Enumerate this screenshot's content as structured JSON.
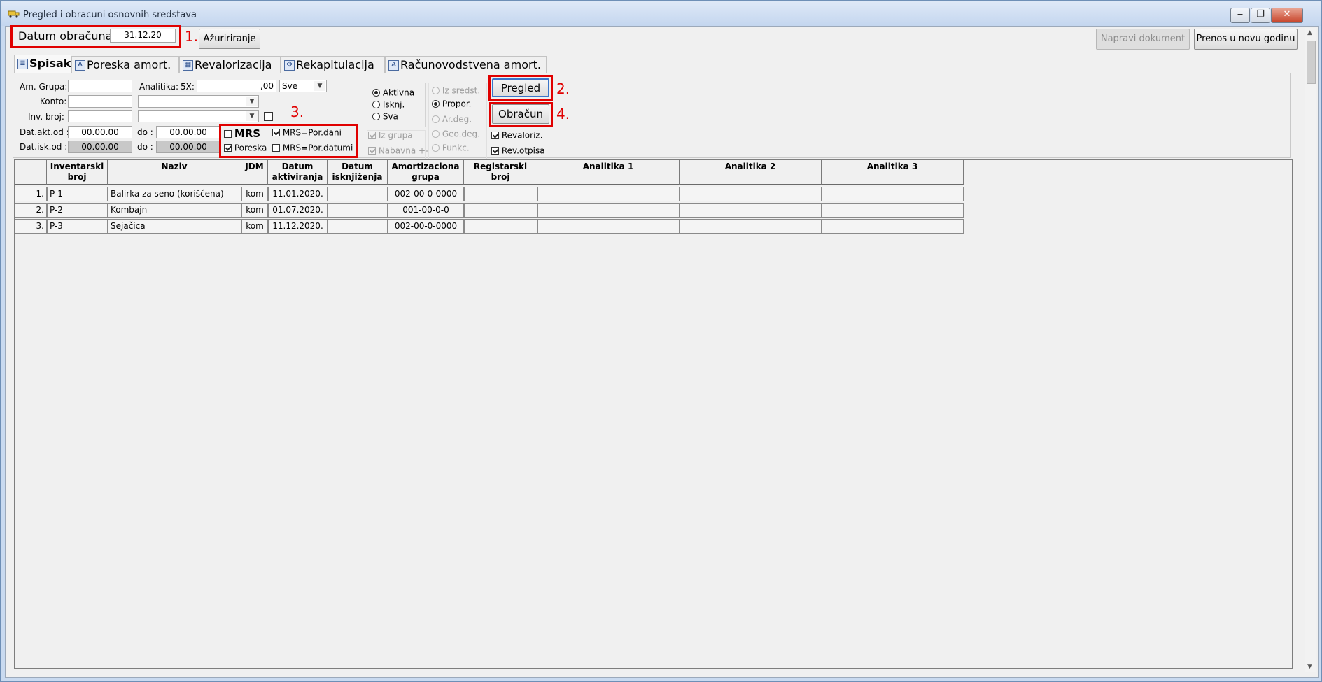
{
  "window": {
    "title": "Pregled i obracuni osnovnih sredstava"
  },
  "toolbar": {
    "datum_label": "Datum obračuna:",
    "datum_value": "31.12.20",
    "azuriranje": "Ažuririranje",
    "napravi_dokument": "Napravi dokument",
    "prenos": "Prenos u novu godinu"
  },
  "annotations": {
    "n1": "1.",
    "n2": "2.",
    "n3": "3.",
    "n4": "4."
  },
  "tabs": [
    {
      "label": "Spisak",
      "icon": "list-icon"
    },
    {
      "label": "Poreska amort.",
      "icon": "a-icon"
    },
    {
      "label": "Revalorizacija",
      "icon": "grid-icon"
    },
    {
      "label": "Rekapitulacija",
      "icon": "gear-icon"
    },
    {
      "label": "Računovodstvena amort.",
      "icon": "a-icon"
    }
  ],
  "filters": {
    "am_grupa": "Am. Grupa:",
    "analitika": "Analitika:",
    "five_x": "5X:",
    "five_x_value": ",00",
    "sve": "Sve",
    "konto": "Konto:",
    "inv_broj": "Inv. broj:",
    "dat_akt_od": "Dat.akt.od :",
    "dat_akt_od_value": "00.00.00",
    "do1": "do :",
    "do1_value": "00.00.00",
    "dat_isk_od": "Dat.isk.od :",
    "dat_isk_od_value": "00.00.00",
    "do2": "do :",
    "do2_value": "00.00.00"
  },
  "mrs_box": {
    "mrs": "MRS",
    "mrs_por_dani": "MRS=Por.dani",
    "poreska": "Poreska",
    "mrs_por_datumi": "MRS=Por.datumi"
  },
  "status_radios": {
    "aktivna": "Aktivna",
    "isknj": "Isknj.",
    "sva": "Sva",
    "iz_grupa": "Iz grupa",
    "nabavna": "Nabavna +-"
  },
  "method_radios": {
    "iz_sredst": "Iz sredst.",
    "propor": "Propor.",
    "ar_deg": "Ar.deg.",
    "geo_deg": "Geo.deg.",
    "funkc": "Funkc."
  },
  "actions": {
    "pregled": "Pregled",
    "obracun": "Obračun",
    "revaloriz": "Revaloriz.",
    "rev_otpisa": "Rev.otpisa"
  },
  "table": {
    "headers": [
      "Inventarski\nbroj",
      "Naziv",
      "JDM",
      "Datum\naktiviranja",
      "Datum\nisknjiženja",
      "Amortizaciona\ngrupa",
      "Registarski broj",
      "Analitika 1",
      "Analitika 2",
      "Analitika 3"
    ],
    "rows": [
      {
        "num": "1.",
        "inv": "P-1",
        "naziv": "Balirka za seno (korišćena)",
        "jdm": "kom",
        "datum_akt": "11.01.2020.",
        "datum_isk": "",
        "grupa": "002-00-0-0000",
        "reg": "",
        "a1": "",
        "a2": "",
        "a3": ""
      },
      {
        "num": "2.",
        "inv": "P-2",
        "naziv": "Kombajn",
        "jdm": "kom",
        "datum_akt": "01.07.2020.",
        "datum_isk": "",
        "grupa": "001-00-0-0",
        "reg": "",
        "a1": "",
        "a2": "",
        "a3": ""
      },
      {
        "num": "3.",
        "inv": "P-3",
        "naziv": "Sejačica",
        "jdm": "kom",
        "datum_akt": "11.12.2020.",
        "datum_isk": "",
        "grupa": "002-00-0-0000",
        "reg": "",
        "a1": "",
        "a2": "",
        "a3": ""
      }
    ]
  }
}
